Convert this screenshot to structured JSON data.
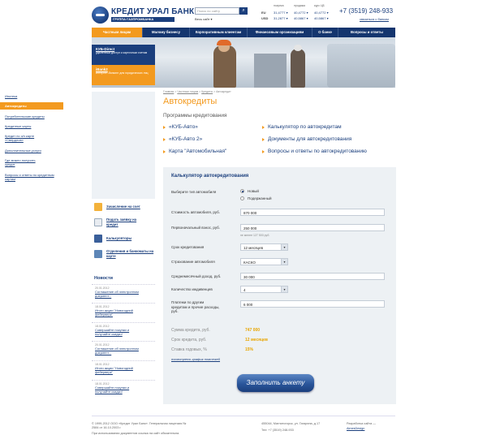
{
  "header": {
    "bank_name": "КРЕДИТ УРАЛ БАНК",
    "group": "ГРУППА ГАЗПРОМБАНКА",
    "search_placeholder": "Поиск по сайту",
    "search_scope": "Весь сайт ▾",
    "rates": {
      "buy_label": "покупка",
      "sell_label": "продажа",
      "cb_label": "курс ЦБ",
      "rows": [
        {
          "currency": "EU",
          "buy": "31,4777 ▾",
          "sell": "40,4772 ▾",
          "cb": "40,4772 ▾"
        },
        {
          "currency": "USD",
          "buy": "31,2877 ▾",
          "sell": "40,5867 ▾",
          "cb": "40,5867 ▾"
        }
      ]
    },
    "phone": "+7 (3519) 248-933",
    "contact_link": "связаться с банком"
  },
  "nav": [
    "Частным лицам",
    "Малому бизнесу",
    "Корпоративным клиентам",
    "Финансовым организациям",
    "О банке",
    "Вопросы и ответы"
  ],
  "promos": [
    {
      "title": "КУБ-Direct",
      "text": "удаленный доступ к карточным счетам"
    },
    {
      "title": "iBank2",
      "text": "интернет-банкинг для юридических лиц"
    }
  ],
  "side_menu": [
    "Ипотека",
    "Автокредиты",
    "Потребительские кредиты",
    "Кредитные карты",
    "Кредит по з/п карте «Свердлов»",
    "Дополнительные услуги",
    "Где можно получить кредит",
    "Вопросы и ответы по кредитным картам"
  ],
  "quick_links": [
    "Зачисление на счет",
    "Подать заявку на кредит",
    "Калькуляторы",
    "Отделения и банкоматы на карте"
  ],
  "news": {
    "title": "Новости",
    "items": [
      {
        "date": "20.01.2012",
        "text": "Соглашение об электронном документ..."
      },
      {
        "date": "18.01.2012",
        "text": "Итоги акции \"Новогодний фейерверк\""
      },
      {
        "date": "18.01.2012",
        "text": "Совершайте покупки и получайте скидки!"
      },
      {
        "date": "20.01.2012",
        "text": "Соглашение об электронном документ..."
      },
      {
        "date": "18.01.2012",
        "text": "Итоги акции \"Новогодний фейерверк\""
      },
      {
        "date": "18.01.2012",
        "text": "Совершайте покупки и получайте скидки!"
      }
    ]
  },
  "breadcrumb": [
    "Главная",
    "Частным лицам",
    "Кредиты",
    "Автокредит"
  ],
  "page_title": "Автокредиты",
  "programs": {
    "heading": "Программы кредитования",
    "left": [
      "«КУБ-Авто»",
      "«КУБ-Авто 2»",
      "Карта \"Автомобильная\""
    ],
    "right": [
      "Калькулятор по автокредитам",
      "Документы для автокредитования",
      "Вопросы и ответы по автокредитованию"
    ]
  },
  "calculator": {
    "title": "Калькулятор автокредитования",
    "car_type_label": "Выберите тип автомобиля",
    "car_type_new": "Новый",
    "car_type_used": "Подержанный",
    "price_label": "Стоимость автомобиля, руб.",
    "price_value": "870 000",
    "down_label": "Первоначальный взнос, руб.",
    "down_value": "250 000",
    "down_hint": "не менее 127 500 руб.",
    "term_label": "Срок кредитования",
    "term_value": "12 месяцев",
    "insurance_label": "Страхование автомобиля",
    "insurance_value": "КАСКО",
    "income_label": "Среднемесячный доход, руб.",
    "income_value": "30 000",
    "dependents_label": "Количество иждивенцев",
    "dependents_value": "4",
    "payments_label": "Платежи по другим кредитам и прочие расходы, руб.",
    "payments_value": "6 000",
    "results": [
      {
        "label": "Сумма кредита, руб.",
        "value": "747 000"
      },
      {
        "label": "Срок кредита, руб.",
        "value": "12 месяцев"
      },
      {
        "label": "Ставка годовых, %",
        "value": "15%"
      }
    ],
    "schedule_link": "посмотреть график платежей",
    "apply_button": "Заполнить анкету"
  },
  "footer": {
    "copyright": "© 1999-2012 ООО «Кредит Урал Банк». Генеральная лицензия № 2584 от 16.10.2003 г.",
    "note": "При использовании документов ссылка на сайт обязательна.",
    "address": "455044, Магнитогорск, ул. Гагарина, д.17",
    "phone": "Тел: +7 (3519) 248-933",
    "dev_label": "Разработка сайта —",
    "dev_name": "AimesDesign"
  },
  "colors": {
    "brand_blue": "#1b3f7d",
    "accent_orange": "#f39a1f"
  }
}
